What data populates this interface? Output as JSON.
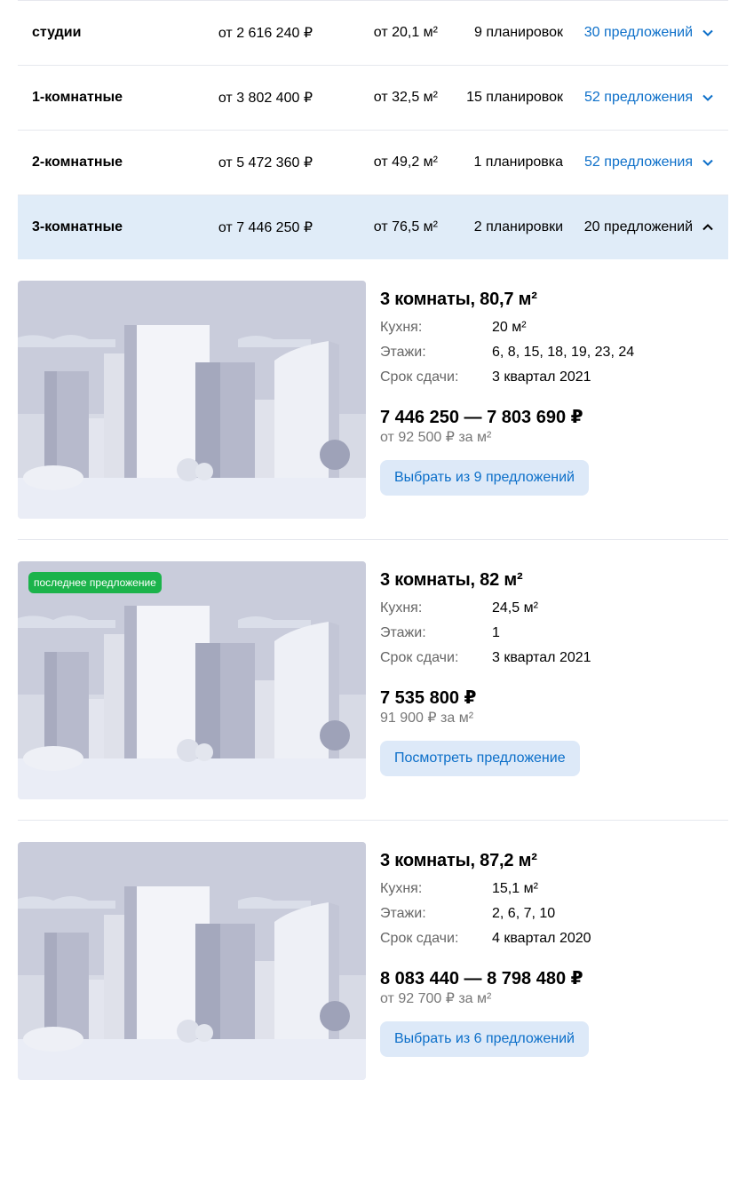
{
  "rows": [
    {
      "name": "студии",
      "price": "от 2 616 240 ₽",
      "area": "от 20,1 м²",
      "plans": "9 планировок",
      "offers": "30 предложений"
    },
    {
      "name": "1-комнатные",
      "price": "от 3 802 400 ₽",
      "area": "от 32,5 м²",
      "plans": "15 планировок",
      "offers": "52 предложения"
    },
    {
      "name": "2-комнатные",
      "price": "от 5 472 360 ₽",
      "area": "от 49,2 м²",
      "plans": "1 планировка",
      "offers": "52 предложения"
    },
    {
      "name": "3-комнатные",
      "price": "от 7 446 250 ₽",
      "area": "от 76,5 м²",
      "plans": "2 планировки",
      "offers": "20 предложений"
    }
  ],
  "labels": {
    "kitchen": "Кухня:",
    "floors": "Этажи:",
    "deadline": "Срок сдачи:"
  },
  "cards": [
    {
      "title": "3 комнаты, 80,7 м²",
      "kitchen": "20 м²",
      "floors": "6, 8, 15, 18, 19, 23, 24",
      "deadline": "3 квартал 2021",
      "price": "7 446 250 — 7 803 690 ₽",
      "ppm": "от 92 500 ₽ за м²",
      "button": "Выбрать из 9 предложений",
      "badge": ""
    },
    {
      "title": "3 комнаты, 82 м²",
      "kitchen": "24,5 м²",
      "floors": "1",
      "deadline": "3 квартал 2021",
      "price": "7 535 800 ₽",
      "ppm": "91 900 ₽ за м²",
      "button": "Посмотреть предложение",
      "badge": "последнее предложение"
    },
    {
      "title": "3 комнаты, 87,2 м²",
      "kitchen": "15,1 м²",
      "floors": "2, 6, 7, 10",
      "deadline": "4 квартал 2020",
      "price": "8 083 440 — 8 798 480 ₽",
      "ppm": "от 92 700 ₽ за м²",
      "button": "Выбрать из 6 предложений",
      "badge": ""
    }
  ],
  "colors": {
    "accent": "#0c6fc9",
    "active_row": "#e0ecf8",
    "button_bg": "#dde9f8",
    "badge_bg": "#1bb34b"
  }
}
